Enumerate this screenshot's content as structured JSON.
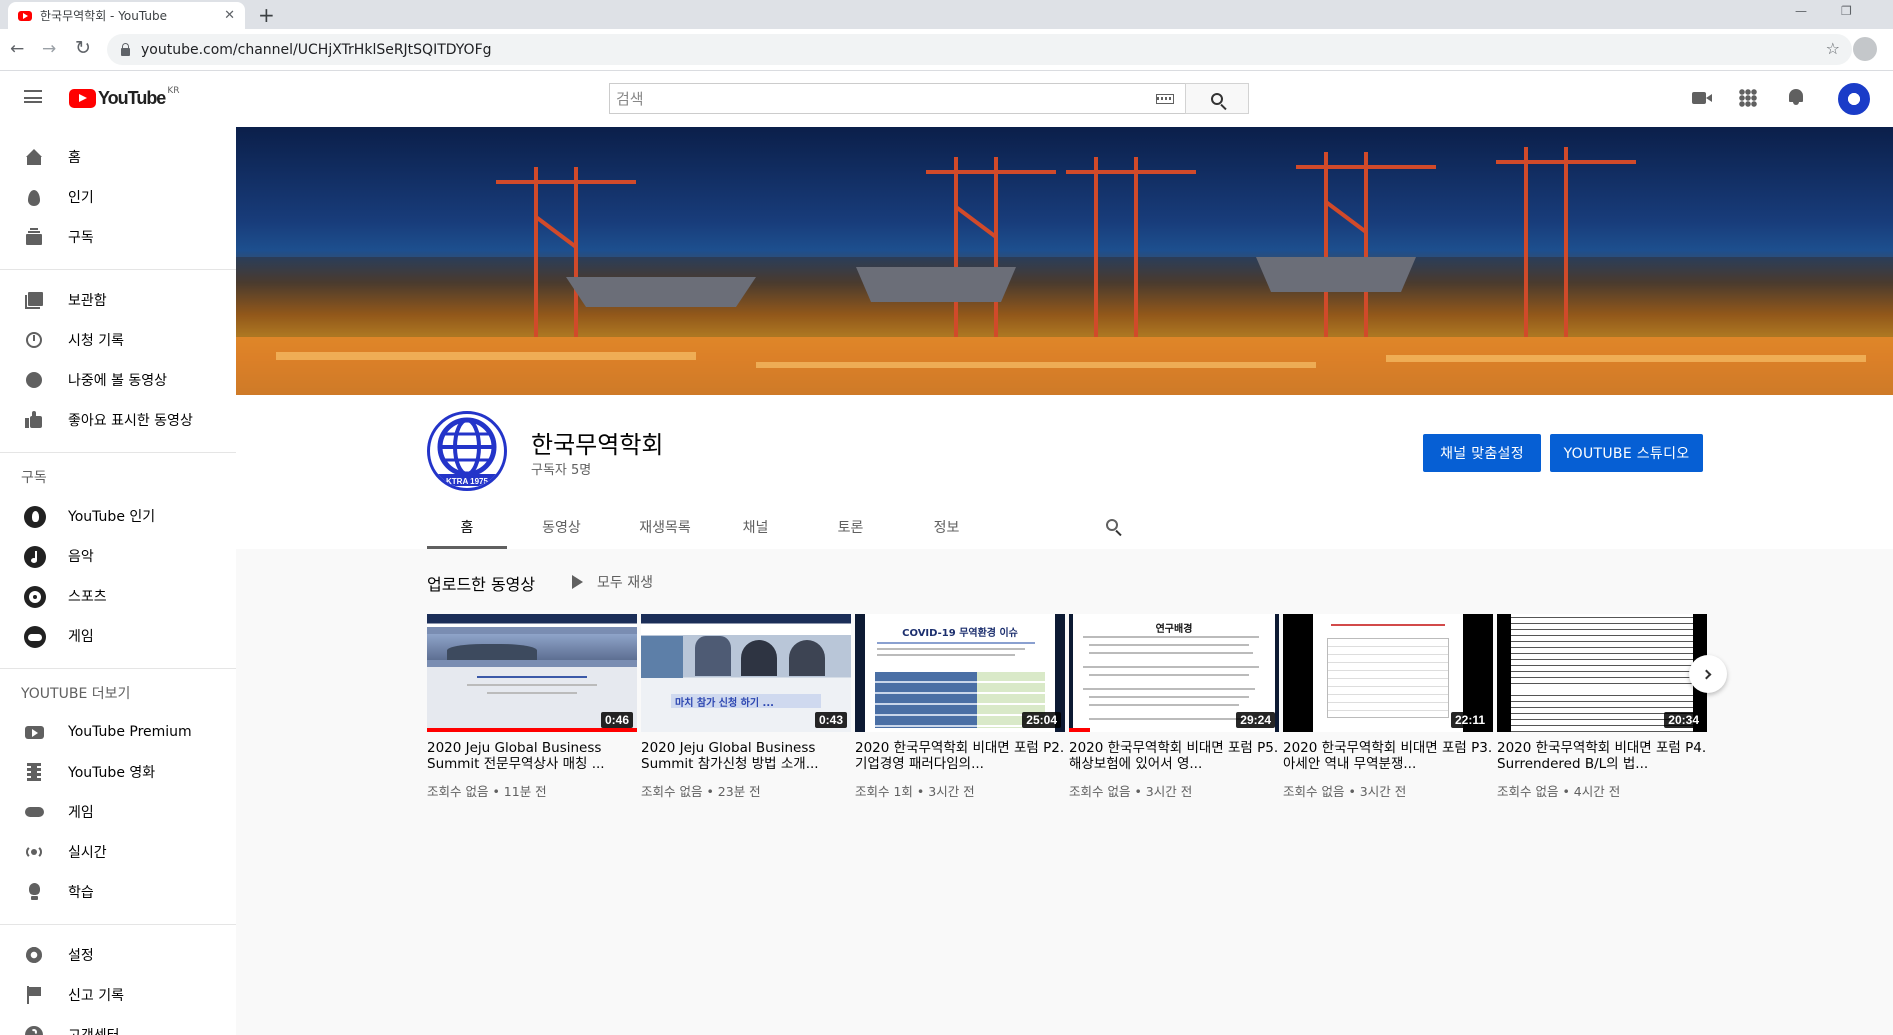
{
  "browser": {
    "tab_title": "한국무역학회 - YouTube",
    "url": "youtube.com/channel/UCHjXTrHklSeRJtSQITDYOFg",
    "new_tab_label": "+"
  },
  "masthead": {
    "logo_word": "YouTube",
    "region": "KR",
    "search_placeholder": "검색"
  },
  "sidebar": {
    "main": [
      {
        "label": "홈",
        "icon": "home-icon"
      },
      {
        "label": "인기",
        "icon": "trending-icon"
      },
      {
        "label": "구독",
        "icon": "subscriptions-icon"
      }
    ],
    "library": [
      {
        "label": "보관함",
        "icon": "library-icon"
      },
      {
        "label": "시청 기록",
        "icon": "history-icon"
      },
      {
        "label": "나중에 볼 동영상",
        "icon": "watch-later-icon"
      },
      {
        "label": "좋아요 표시한 동영상",
        "icon": "liked-icon"
      }
    ],
    "subscriptions_heading": "구독",
    "subscriptions": [
      {
        "label": "YouTube 인기",
        "icon": "youtube-popular-icon"
      },
      {
        "label": "음악",
        "icon": "music-icon"
      },
      {
        "label": "스포츠",
        "icon": "sports-icon"
      },
      {
        "label": "게임",
        "icon": "gaming-icon"
      }
    ],
    "more_heading": "YOUTUBE 더보기",
    "more": [
      {
        "label": "YouTube Premium",
        "icon": "premium-icon"
      },
      {
        "label": "YouTube 영화",
        "icon": "movies-icon"
      },
      {
        "label": "게임",
        "icon": "gaming-icon"
      },
      {
        "label": "실시간",
        "icon": "live-icon"
      },
      {
        "label": "학습",
        "icon": "learning-icon"
      }
    ],
    "settings": [
      {
        "label": "설정",
        "icon": "settings-icon"
      },
      {
        "label": "신고 기록",
        "icon": "flag-icon"
      },
      {
        "label": "고객센터",
        "icon": "help-icon"
      }
    ]
  },
  "channel": {
    "name": "한국무역학회",
    "subscribers": "구독자 5명",
    "customize_button": "채널 맞춤설정",
    "studio_button": "YOUTUBE 스튜디오",
    "avatar_text": "KTRA 1975",
    "tabs": [
      "홈",
      "동영상",
      "재생목록",
      "채널",
      "토론",
      "정보"
    ],
    "active_tab": "홈"
  },
  "shelf": {
    "title": "업로드한 동영상",
    "play_all": "모두 재생",
    "videos": [
      {
        "title": "2020 Jeju Global Business Summit 전문무역상사 매칭 ...",
        "meta": "조회수 없음 • 11분 전",
        "duration": "0:46",
        "progress": 1.0
      },
      {
        "title": "2020 Jeju Global Business Summit 참가신청 방법 소개...",
        "meta": "조회수 없음 • 23분 전",
        "duration": "0:43",
        "progress": 0,
        "thumb_caption": "마치 참가 신청 하기 ..."
      },
      {
        "title": "2020 한국무역학회 비대면 포럼 P2. 기업경영 패러다임의...",
        "meta": "조회수 1회 • 3시간 전",
        "duration": "25:04",
        "progress": 0,
        "thumb_heading": "COVID-19 무역환경 이슈"
      },
      {
        "title": "2020 한국무역학회 비대면 포럼 P5. 해상보험에 있어서 영...",
        "meta": "조회수 없음 • 3시간 전",
        "duration": "29:24",
        "progress": 0.1,
        "thumb_heading": "연구배경"
      },
      {
        "title": "2020 한국무역학회 비대면 포럼 P3. 아세안 역내 무역분쟁...",
        "meta": "조회수 없음 • 3시간 전",
        "duration": "22:11",
        "progress": 0
      },
      {
        "title": "2020 한국무역학회 비대면 포럼 P4. Surrendered B/L의 법...",
        "meta": "조회수 없음 • 4시간 전",
        "duration": "20:34",
        "progress": 0
      }
    ]
  },
  "colors": {
    "youtube_red": "#ff0000",
    "button_blue": "#065fd4",
    "channel_avatar_blue": "#2334c9"
  }
}
